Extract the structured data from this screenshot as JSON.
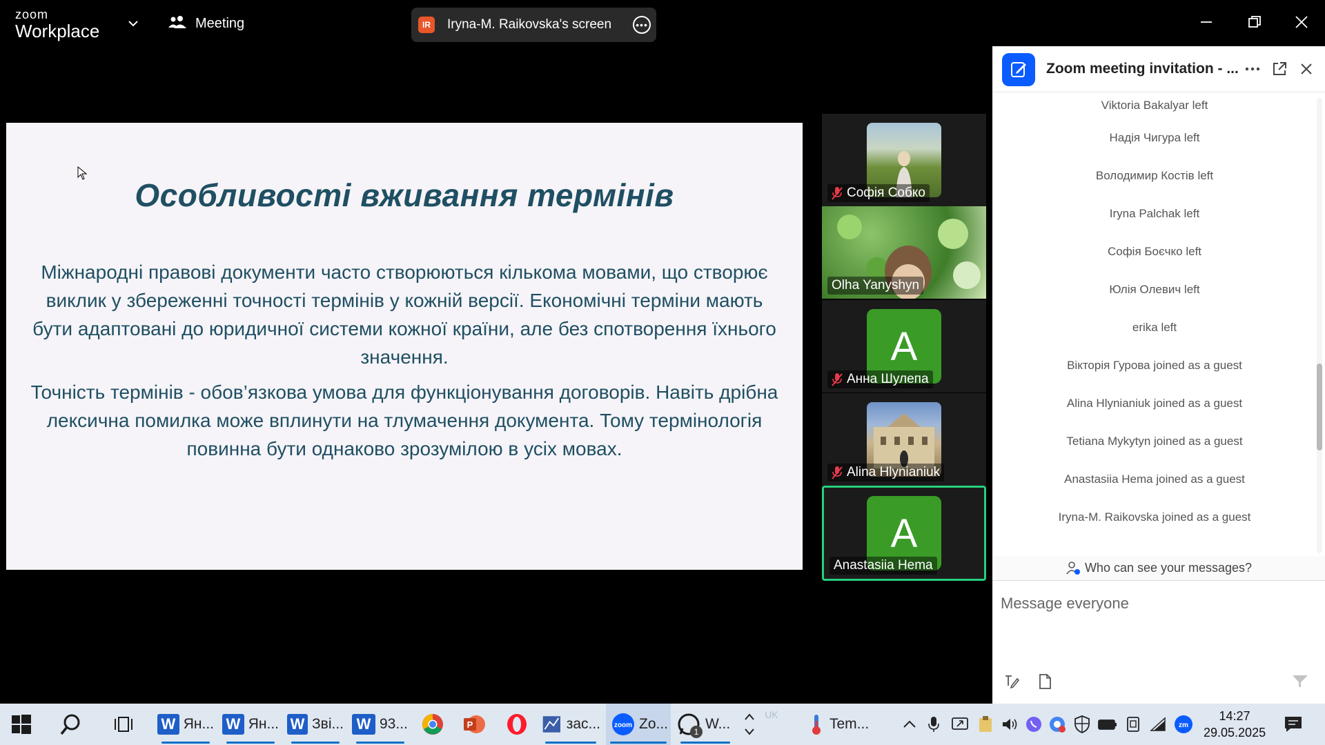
{
  "topbar": {
    "brand_top": "zoom",
    "brand_bottom": "Workplace",
    "meeting_label": "Meeting",
    "share_badge": "IR",
    "share_label": "Iryna-M. Raikovska's screen"
  },
  "slide": {
    "title": "Особливості вживання термінів",
    "paragraphs": [
      "Міжнародні правові документи часто створюються кількома мовами, що створює виклик у збереженні точності термінів у кожній версії. Економічні терміни мають бути адаптовані до юридичної системи кожної країни, але без спотворення їхнього значення.",
      "Точність термінів - обов’язкова умова для функціонування договорів. Навіть дрібна лексична помилка може вплинути на тлумачення документа. Тому термінологія повинна бути однаково зрозумілою в усіх мовах."
    ]
  },
  "gallery": {
    "tiles": [
      {
        "name": "Софія Собко",
        "muted": true,
        "kind": "photo"
      },
      {
        "name": "Olha Yanyshyn",
        "muted": false,
        "kind": "photo"
      },
      {
        "name": "Анна Шулепа",
        "muted": true,
        "kind": "avatar",
        "initial": "A"
      },
      {
        "name": "Alina Hlynianiuk",
        "muted": true,
        "kind": "photo"
      },
      {
        "name": "Anastasiia Hema",
        "muted": false,
        "kind": "avatar",
        "initial": "A",
        "active": true
      }
    ]
  },
  "chat": {
    "title": "Zoom meeting invitation - ...",
    "messages": [
      "Viktoria Bakalyar left",
      "Надія Чигура left",
      "Володимир Костів left",
      "Iryna Palchak left",
      "Софія Боєчко left",
      "Юлія Олевич left",
      "erika left",
      "Вікторія Гурова joined as a guest",
      "Alina Hlynianiuk joined as a guest",
      "Tetiana Mykytyn joined as a guest",
      "Anastasiia Hema joined as a guest",
      "Iryna-M. Raikovska joined as a guest"
    ],
    "visibility_label": "Who can see your messages?",
    "input_placeholder": "Message everyone"
  },
  "taskbar": {
    "items": [
      {
        "label": "Ян..."
      },
      {
        "label": "Ян..."
      },
      {
        "label": "Зві..."
      },
      {
        "label": "93..."
      },
      {
        "label": "зас..."
      },
      {
        "label": "Zo..."
      },
      {
        "label": "W..."
      }
    ],
    "whatsapp_badge": "1",
    "lang": "UK",
    "weather_label": "Tem...",
    "time": "14:27",
    "date": "29.05.2025"
  },
  "colors": {
    "accent": "#0b5cff",
    "active_speaker": "#26d07c",
    "slide_text": "#1f4f63",
    "avatar_green": "#3a9b27"
  }
}
